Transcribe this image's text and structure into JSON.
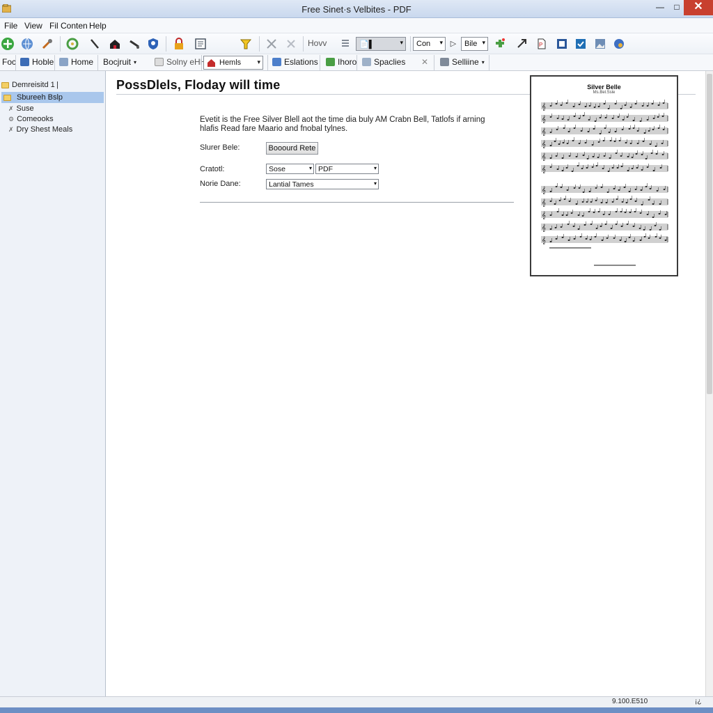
{
  "window": {
    "title": "Free Sinet·s Velbites - PDF",
    "minimize_glyph": "—",
    "maximize_glyph": "□",
    "close_glyph": "✕"
  },
  "menu": [
    "File",
    "View",
    "Fil Conten",
    "Help"
  ],
  "toolbar1": {
    "how_label": "Hovv",
    "combo_value": "📄▌",
    "combo2_value": "Con",
    "combo3_value": "Bile"
  },
  "toolbar2": {
    "foc": "Foc",
    "hoble": "Hoble",
    "home": "Home",
    "bocjruit": "Bocjruit",
    "solny": "Solny eHHI",
    "hemls": "Hemls",
    "eslations": "Eslations",
    "ihoro": "Ihoro",
    "spaclies": "Spaclies",
    "selliine": "Selliine"
  },
  "sidebar": {
    "items": [
      {
        "label": "Demreisitd 1 |"
      },
      {
        "label": "Sbureeh Bslp"
      },
      {
        "label": "Suse"
      },
      {
        "label": "Comeooks"
      },
      {
        "label": "Dry Shest Meals"
      }
    ]
  },
  "main": {
    "heading": "PossDlels, Floday will time",
    "description": "Evetit is the Free Silver Blell aot the time dia buly AM Crabn Bell, Tatlofs if arning hlafis Read fare Maario and fnobal tylnes.",
    "silver_label": "Slurer Bele:",
    "silver_button": "Booourd Rete",
    "cratotl_label": "Cratotl:",
    "cratotl_select1": "Sose",
    "cratotl_select2": "PDF",
    "norie_label": "Norie Dane:",
    "norie_select": "Lantial Tames"
  },
  "sheet": {
    "title": "Silver Belle",
    "subtitle": "Ms.Bel.Ssle"
  },
  "status": {
    "coords": "9.100.E510",
    "help": "¡¿"
  },
  "colors": {
    "accent": "#a9c7ec",
    "title_bar": "#c9d8ee",
    "close_button": "#c8402f"
  }
}
